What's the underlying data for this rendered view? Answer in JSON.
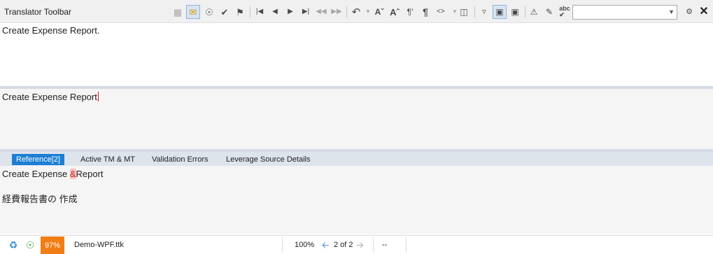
{
  "toolbar": {
    "title": "Translator Toolbar",
    "search": {
      "value": "",
      "placeholder": ""
    }
  },
  "icons": {
    "lock": "lock-icon",
    "mail": "mail-icon",
    "eye": "eye-icon",
    "check": "check-icon",
    "flag": "flag-icon",
    "first": "first-icon",
    "prev": "prev-icon",
    "next": "next-icon",
    "last": "last-icon",
    "undo": "undo-icon",
    "pilcrow": "pilcrow-icon"
  },
  "source_segment": {
    "text": "Create Expense Report."
  },
  "target_segment": {
    "text": "Create Expense Report"
  },
  "tabs": [
    {
      "label": "Reference[2]",
      "active": true
    },
    {
      "label": "Active TM & MT",
      "active": false
    },
    {
      "label": "Validation Errors",
      "active": false
    },
    {
      "label": "Leverage Source Details",
      "active": false
    }
  ],
  "reference": {
    "line1_before": "Create Expense ",
    "line1_marker": "&",
    "line1_after": "Report",
    "line2": "経費報告書の 作成"
  },
  "status": {
    "match_percent": "97%",
    "file_name": "Demo-WPF.ttk",
    "zoom": "100%",
    "position": "2 of 2",
    "extra": "--"
  },
  "colors": {
    "tab_active": "#1c7fd4",
    "match_badge": "#f07d16",
    "marker": "#d21d1d"
  }
}
